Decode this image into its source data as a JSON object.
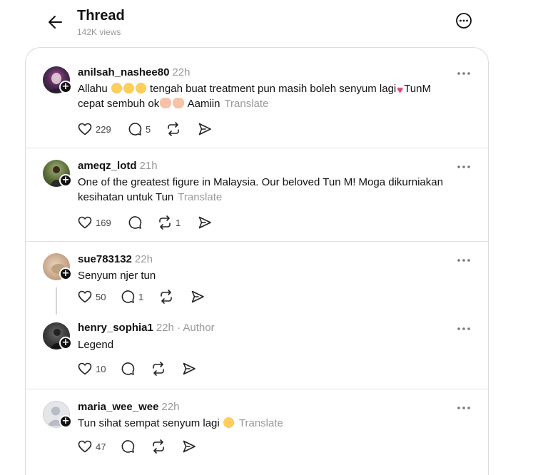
{
  "header": {
    "title": "Thread",
    "views": "142K views"
  },
  "posts": [
    {
      "username": "anilsah_nashee80",
      "time": "22h",
      "text_a": "Allahu",
      "text_b": "tengah buat treatment pun masih boleh senyum lagi",
      "text_c": "TunM",
      "text_d": "cepat sembuh ok",
      "text_e": "Aamiin",
      "translate": "Translate",
      "likes": "229",
      "replies": "5",
      "reposts": ""
    },
    {
      "username": "ameqz_lotd",
      "time": "21h",
      "text": "One of the greatest figure in Malaysia. Our beloved Tun M! Moga dikurniakan kesihatan untuk Tun",
      "translate": "Translate",
      "likes": "169",
      "replies": "",
      "reposts": "1"
    },
    {
      "username": "sue783132",
      "time": "22h",
      "text": "Senyum njer tun",
      "likes": "50",
      "replies": "1",
      "reposts": ""
    },
    {
      "username": "henry_sophia1",
      "time": "22h",
      "author_tag": "· Author",
      "text": "Legend",
      "likes": "10",
      "replies": "",
      "reposts": ""
    },
    {
      "username": "maria_wee_wee",
      "time": "22h",
      "text": "Tun sihat sempat senyum lagi",
      "translate": "Translate",
      "likes": "47",
      "replies": "",
      "reposts": ""
    }
  ],
  "icons": {
    "back": "arrow-left-icon",
    "more": "more-circle-icon",
    "like": "heart-icon",
    "reply": "comment-icon",
    "repost": "repost-icon",
    "share": "send-icon"
  }
}
